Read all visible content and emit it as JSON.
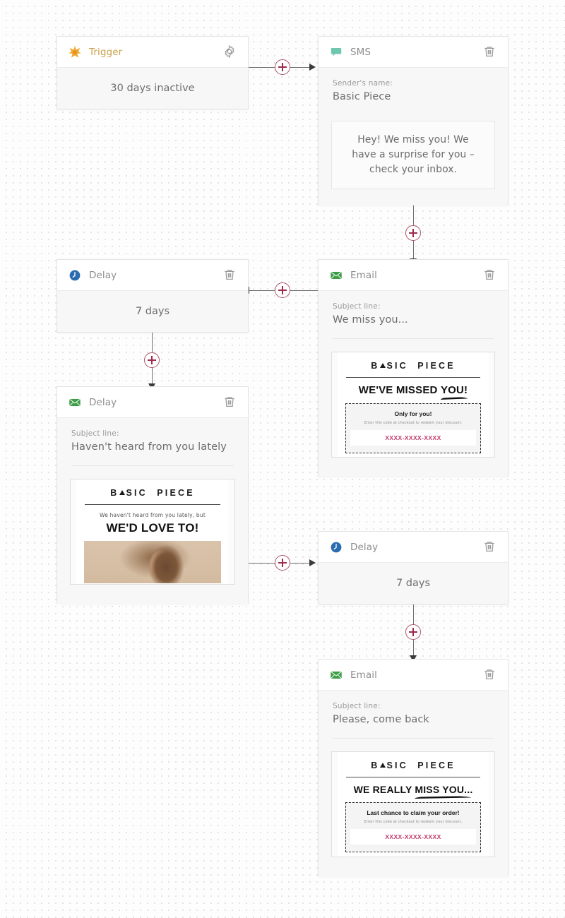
{
  "workflow": {
    "nodes": [
      {
        "id": "trigger",
        "type": "trigger",
        "icon": "starburst-icon",
        "title": "Trigger",
        "action_icon": "gear-icon",
        "value": "30 days inactive"
      },
      {
        "id": "sms",
        "type": "sms",
        "icon": "speech-bubble-icon",
        "title": "SMS",
        "action_icon": "trash-icon",
        "field_label": "Sender's name:",
        "field_value": "Basic Piece",
        "message": "Hey! We miss you! We have a surprise for you – check your inbox."
      },
      {
        "id": "delay-1",
        "type": "delay",
        "icon": "clock-icon",
        "title": "Delay",
        "action_icon": "trash-icon",
        "value": "7 days"
      },
      {
        "id": "email-1",
        "type": "email",
        "icon": "envelope-icon",
        "title": "Email",
        "action_icon": "trash-icon",
        "field_label": "Subject line:",
        "field_value": "We miss you...",
        "preview": {
          "brand": "BASIC PIECE",
          "headline": "WE'VE MISSED YOU!",
          "headline_underlined": "YOU!",
          "coupon_title": "Only for you!",
          "coupon_sub": "Enter this code at checkout to redeem your discount.",
          "coupon_code": "XXXX-XXXX-XXXX"
        }
      },
      {
        "id": "email-2",
        "type": "email",
        "icon": "envelope-icon",
        "title": "Delay",
        "action_icon": "trash-icon",
        "field_label": "Subject line:",
        "field_value": "Haven't heard from you lately",
        "preview": {
          "brand": "BASIC PIECE",
          "kicker": "We haven't heard from you lately, but",
          "headline": "WE'D LOVE TO!"
        }
      },
      {
        "id": "delay-2",
        "type": "delay",
        "icon": "clock-icon",
        "title": "Delay",
        "action_icon": "trash-icon",
        "value": "7 days"
      },
      {
        "id": "email-3",
        "type": "email",
        "icon": "envelope-icon",
        "title": "Email",
        "action_icon": "trash-icon",
        "field_label": "Subject line:",
        "field_value": "Please, come back",
        "preview": {
          "brand": "BASIC PIECE",
          "headline": "WE REALLY MISS YOU...",
          "headline_underlined": "MISS YOU...",
          "coupon_title": "Last chance to claim your order!",
          "coupon_sub": "Enter this code at checkout to redeem your discount.",
          "coupon_code": "XXXX-XXXX-XXXX"
        }
      }
    ],
    "add_step_label": "+"
  },
  "colors": {
    "trigger_accent": "#e8a33d",
    "sms_accent": "#6ec6b0",
    "email_accent": "#3d9c47",
    "delay_accent": "#2b6cb0",
    "connector_accent": "#9e2b4e",
    "coupon_code": "#c0396b"
  }
}
